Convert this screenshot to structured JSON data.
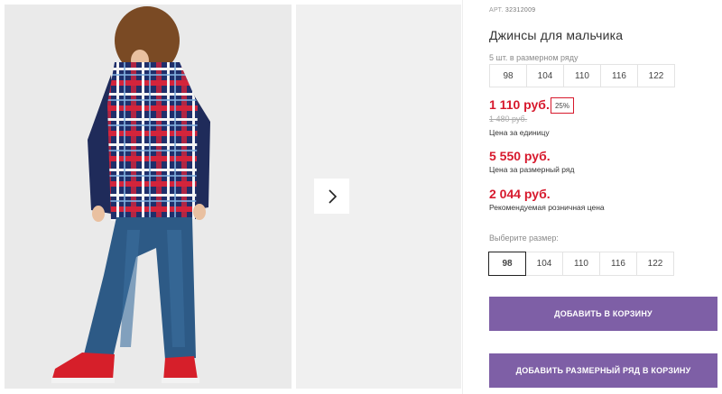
{
  "product": {
    "art_label": "АРТ.",
    "art_number": "32312009",
    "title": "Джинсы для мальчика",
    "row_note": "5 шт. в размерном ряду",
    "row_sizes": [
      "98",
      "104",
      "110",
      "116",
      "122"
    ],
    "unit_price": "1 110 руб.",
    "discount": "25%",
    "old_price": "1 480 руб.",
    "unit_price_caption": "Цена за единицу",
    "row_price": "5 550 руб.",
    "row_price_caption": "Цена за размерный ряд",
    "retail_price": "2 044 руб.",
    "retail_price_caption": "Рекомендуемая розничная цена",
    "choose_size_label": "Выберите размер:",
    "pick_sizes": [
      "98",
      "104",
      "110",
      "116",
      "122"
    ],
    "selected_size": "98",
    "add_to_cart": "ДОБАВИТЬ В КОРЗИНУ",
    "add_row_to_cart": "ДОБАВИТЬ РАЗМЕРНЫЙ РЯД В КОРЗИНУ"
  },
  "gallery": {
    "next_icon": "chevron-right-icon"
  },
  "colors": {
    "accent": "#7e5fa6",
    "price": "#d7192d"
  }
}
